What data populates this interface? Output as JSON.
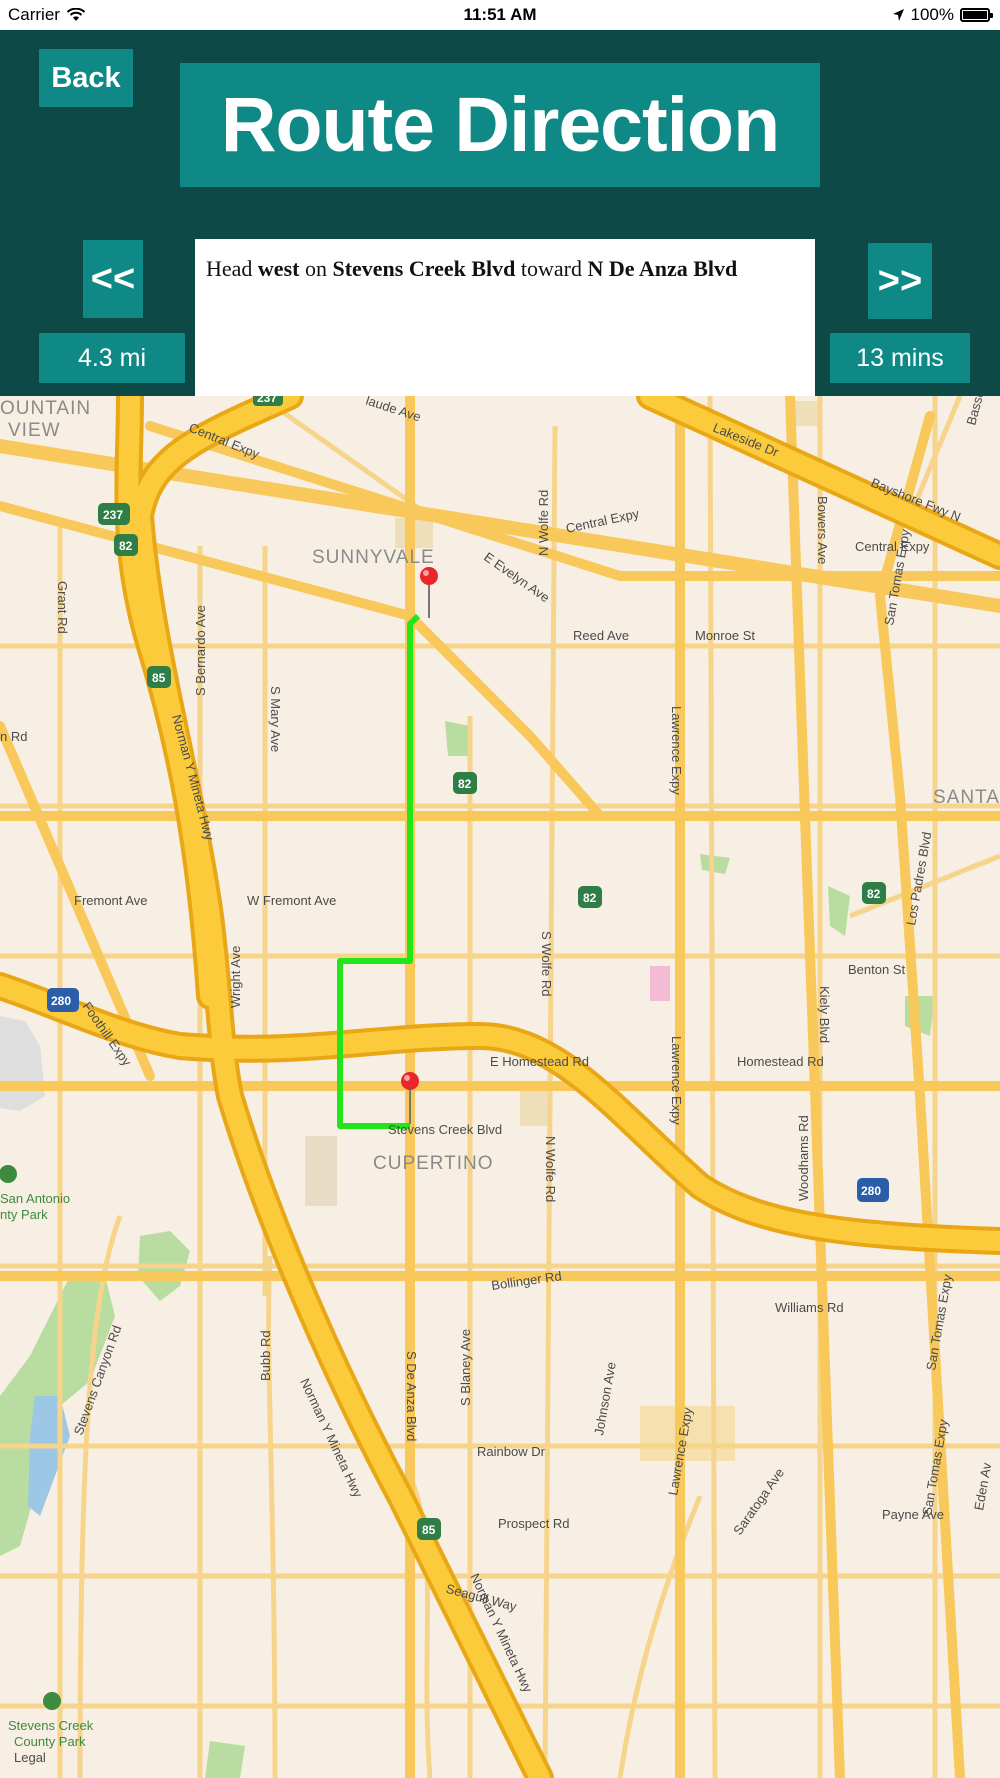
{
  "status_bar": {
    "carrier": "Carrier",
    "time": "11:51 AM",
    "battery": "100%"
  },
  "header": {
    "back_label": "Back",
    "title": "Route Direction",
    "prev_label": "<<",
    "next_label": ">>",
    "distance": "4.3 mi",
    "duration": "13 mins",
    "instruction": {
      "head": "Head",
      "direction": "west",
      "on": "on",
      "street": "Stevens Creek Blvd",
      "toward": "toward",
      "destination": "N De Anza Blvd"
    }
  },
  "colors": {
    "header_bg": "#0d4a47",
    "button_teal": "#0f8985",
    "route_green": "#22e61a",
    "highway_orange": "#f5b51e",
    "pin_red": "#e8262b"
  },
  "map": {
    "cities": [
      "OUNTAIN",
      "VIEW",
      "SUNNYVALE",
      "CUPERTINO",
      "SANTA"
    ],
    "streets": [
      "Central Expy",
      "Lakeside Dr",
      "Bayshore Fwy N",
      "Central Expy",
      "Central Expy",
      "Grant Rd",
      "E Evelyn Ave",
      "N Wolfe Rd",
      "Bowers Ave",
      "Reed Ave",
      "Monroe St",
      "Lawrence Expy",
      "n Rd",
      "S Bernardo Ave",
      "S Mary Ave",
      "San Tomas Expy",
      "Norman Y Mineta Hwy",
      "Fremont Ave",
      "W Fremont Ave",
      "S Wolfe Rd",
      "Benton St",
      "Wright Ave",
      "Kiely Blvd",
      "Los Padres Blvd",
      "Foothill Expy",
      "E Homestead Rd",
      "Homestead Rd",
      "Lawrence Expy",
      "N Wolfe Rd",
      "Woodhams Rd",
      "San Tomas Expy",
      "Stevens Creek Blvd",
      "Bubb Rd",
      "Norman Y Mineta Hwy",
      "S De Anza Blvd",
      "S Blaney Ave",
      "Bollinger Rd",
      "Williams Rd",
      "Stevens Canyon Rd",
      "Johnson Ave",
      "Rainbow Dr",
      "Lawrence Expy",
      "Saratoga Ave",
      "Payne Ave",
      "San Tomas Expy",
      "Prospect Rd",
      "Seagull Way",
      "Norman Y Mineta Hwy",
      "Eden Av",
      "Bassett",
      "laude Ave"
    ],
    "shields": [
      "237",
      "237",
      "82",
      "85",
      "82",
      "82",
      "82",
      "280",
      "280",
      "85"
    ],
    "parks": [
      "San Antonio",
      "nty Park",
      "Stevens Creek",
      "County Park"
    ],
    "legal": "Legal"
  }
}
